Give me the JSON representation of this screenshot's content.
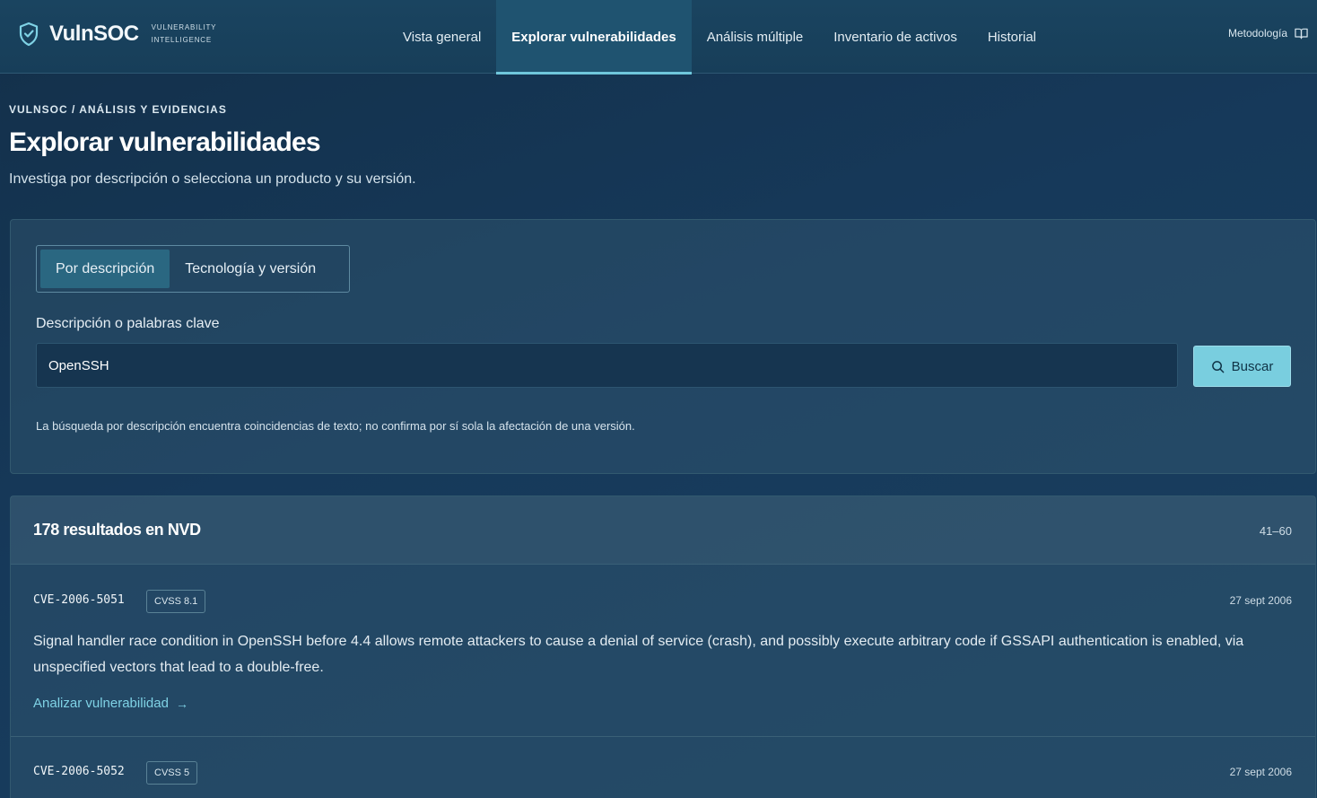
{
  "brand": {
    "name": "VulnSOC",
    "sub1": "VULNERABILITY",
    "sub2": "INTELLIGENCE"
  },
  "nav": {
    "items": [
      {
        "label": "Vista general"
      },
      {
        "label": "Explorar vulnerabilidades",
        "active": true
      },
      {
        "label": "Análisis múltiple"
      },
      {
        "label": "Inventario de activos"
      },
      {
        "label": "Historial"
      }
    ],
    "methodology": "Metodología"
  },
  "header": {
    "breadcrumb": "VULNSOC / ANÁLISIS Y EVIDENCIAS",
    "title": "Explorar vulnerabilidades",
    "subtitle": "Investiga por descripción o selecciona un producto y su versión."
  },
  "search": {
    "tabs": [
      {
        "label": "Por descripción",
        "active": true
      },
      {
        "label": "Tecnología y versión"
      }
    ],
    "field_label": "Descripción o palabras clave",
    "value": "OpenSSH",
    "button": "Buscar",
    "hint": "La búsqueda por descripción encuentra coincidencias de texto; no confirma por sí sola la afectación de una versión."
  },
  "results": {
    "title": "178 resultados en NVD",
    "range": "41–60",
    "items": [
      {
        "id": "CVE-2006-5051",
        "cvss": "CVSS 8.1",
        "date": "27 sept 2006",
        "description": "Signal handler race condition in OpenSSH before 4.4 allows remote attackers to cause a denial of service (crash), and possibly execute arbitrary code if GSSAPI authentication is enabled, via unspecified vectors that lead to a double-free.",
        "link": "Analizar vulnerabilidad"
      },
      {
        "id": "CVE-2006-5052",
        "cvss": "CVSS 5",
        "date": "27 sept 2006"
      }
    ]
  },
  "colors": {
    "accent": "#79cedf",
    "link": "#7fd2e5",
    "background": "#16395a"
  },
  "icons": {
    "brand": "shield-check-icon",
    "methodology": "book-open-icon",
    "search": "search-icon",
    "arrow": "arrow-right-icon"
  }
}
